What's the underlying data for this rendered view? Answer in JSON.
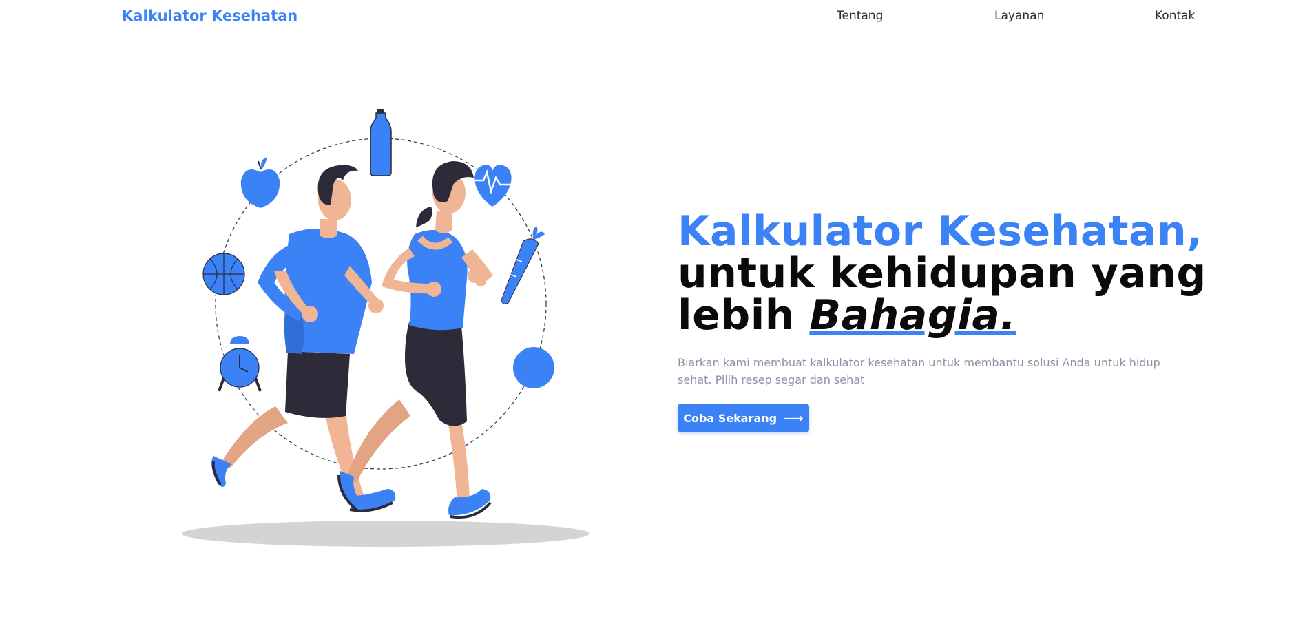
{
  "nav": {
    "brand": "Kalkulator Kesehatan",
    "links": [
      {
        "label": "Tentang"
      },
      {
        "label": "Layanan"
      },
      {
        "label": "Kontak"
      }
    ]
  },
  "hero": {
    "headline_accent": "Kalkulator Kesehatan,",
    "headline_line2": "untuk kehidupan yang",
    "headline_line3_prefix": "lebih ",
    "headline_emphasis": "Bahagia.",
    "subtitle": "Biarkan kami membuat kalkulator kesehatan untuk membantu solusi Anda untuk hidup sehat. Pilih resep segar dan sehat",
    "cta_label": "Coba Sekarang",
    "cta_icon": "arrow-right-icon"
  },
  "colors": {
    "accent": "#3b82f6",
    "text_dark": "#0a0a0a",
    "text_muted": "#8b93a7",
    "skin": "#f0b594",
    "hair": "#2d2b3a",
    "shadow": "#d4d4d4"
  },
  "illustration": {
    "icons": [
      "water-bottle-icon",
      "heartbeat-icon",
      "carrot-icon",
      "ball-icon",
      "alarm-clock-icon",
      "basketball-icon",
      "apple-icon"
    ]
  }
}
